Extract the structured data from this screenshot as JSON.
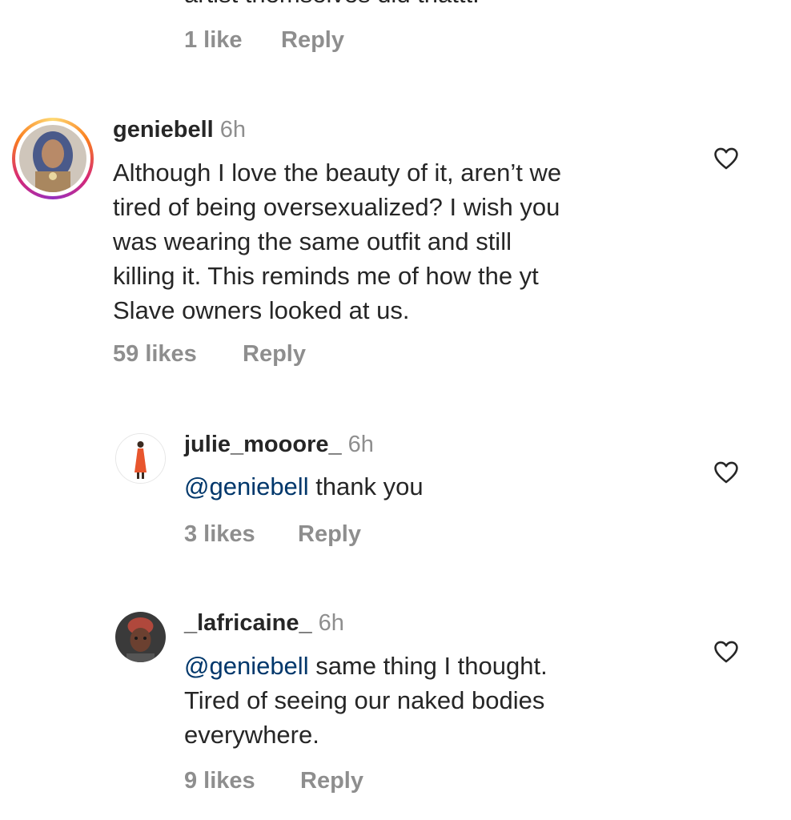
{
  "top_fragment": {
    "text_cut": "artist themselves did thattt.",
    "likes": "1 like",
    "reply": "Reply"
  },
  "comments": [
    {
      "username": "geniebell",
      "time": "6h",
      "lines": [
        "Although I love the beauty of it, aren’t we",
        "tired of being oversexualized? I wish you",
        "was wearing the same outfit and still",
        "killing it. This reminds me of how the yt",
        "Slave owners looked at us."
      ],
      "likes": "59 likes",
      "reply": "Reply",
      "avatar_icon": "profile-photo-icon",
      "heart_icon": "heart-outline-icon"
    },
    {
      "username": "julie_mooore_",
      "time": "6h",
      "mention": "@geniebell",
      "text_after_mention": " thank you",
      "likes": "3 likes",
      "reply": "Reply",
      "avatar_icon": "profile-photo-icon",
      "heart_icon": "heart-outline-icon"
    },
    {
      "username": "_lafricaine_",
      "time": "6h",
      "mention": "@geniebell",
      "text_after_mention": " same thing I thought.",
      "lines_after": [
        "Tired of seeing our naked bodies",
        "everywhere."
      ],
      "likes": "9 likes",
      "reply": "Reply",
      "avatar_icon": "profile-photo-icon",
      "heart_icon": "heart-outline-icon"
    }
  ],
  "colors": {
    "text": "#262626",
    "muted": "#8e8e8e",
    "mention": "#00376b",
    "story_ring": "#d62976"
  }
}
